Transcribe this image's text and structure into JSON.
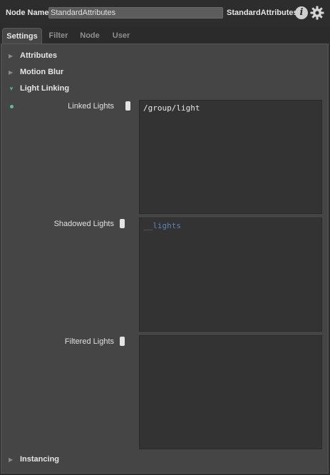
{
  "header": {
    "node_name_label": "Node Name",
    "node_name_value": "StandardAttributes",
    "node_type": "StandardAttributes",
    "info_icon": "info-icon",
    "gear_icon": "gear-icon"
  },
  "tabs": [
    {
      "label": "Settings",
      "active": true
    },
    {
      "label": "Filter",
      "active": false
    },
    {
      "label": "Node",
      "active": false
    },
    {
      "label": "User",
      "active": false
    }
  ],
  "sections": [
    {
      "label": "Attributes",
      "expanded": false
    },
    {
      "label": "Motion Blur",
      "expanded": false
    },
    {
      "label": "Light Linking",
      "expanded": true
    },
    {
      "label": "Instancing",
      "expanded": false
    }
  ],
  "light_linking": {
    "linked_lights": {
      "label": "Linked Lights",
      "value": "/group/light"
    },
    "shadowed_lights": {
      "label": "Shadowed Lights",
      "value": "__lights"
    },
    "filtered_lights": {
      "label": "Filtered Lights",
      "value": ""
    }
  },
  "colors": {
    "accent_green": "#5fbf91",
    "expression_blue": "#5a86b3",
    "panel_bg": "#454545"
  }
}
